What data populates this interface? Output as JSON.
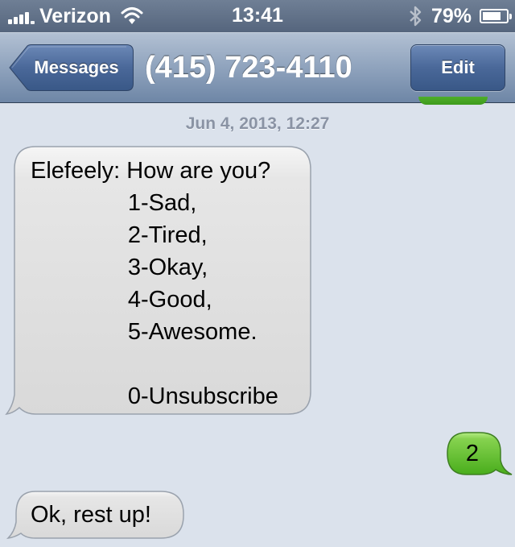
{
  "status_bar": {
    "carrier": "Verizon",
    "time": "13:41",
    "battery_percent": "79%",
    "battery_level": 0.79,
    "icons": [
      "signal-icon",
      "wifi-icon",
      "bluetooth-icon",
      "battery-icon"
    ]
  },
  "nav": {
    "back_label": "Messages",
    "title": "(415) 723-4110",
    "edit_label": "Edit"
  },
  "conversation": {
    "timestamp": "Jun 4, 2013, 12:27",
    "messages": [
      {
        "direction": "incoming",
        "text": "Elefeely: How are you?\n               1-Sad,\n               2-Tired,\n               3-Okay,\n               4-Good,\n               5-Awesome.\n\n               0-Unsubscribe"
      },
      {
        "direction": "outgoing",
        "text": "2"
      },
      {
        "direction": "incoming",
        "text": "Ok, rest up!"
      }
    ]
  },
  "colors": {
    "background": "#dbe2ec",
    "incoming_bubble": "#e5e5e5",
    "outgoing_bubble": "#5cbd33",
    "nav_bar": "#8fa3bd",
    "status_bar": "#5b6b82"
  }
}
